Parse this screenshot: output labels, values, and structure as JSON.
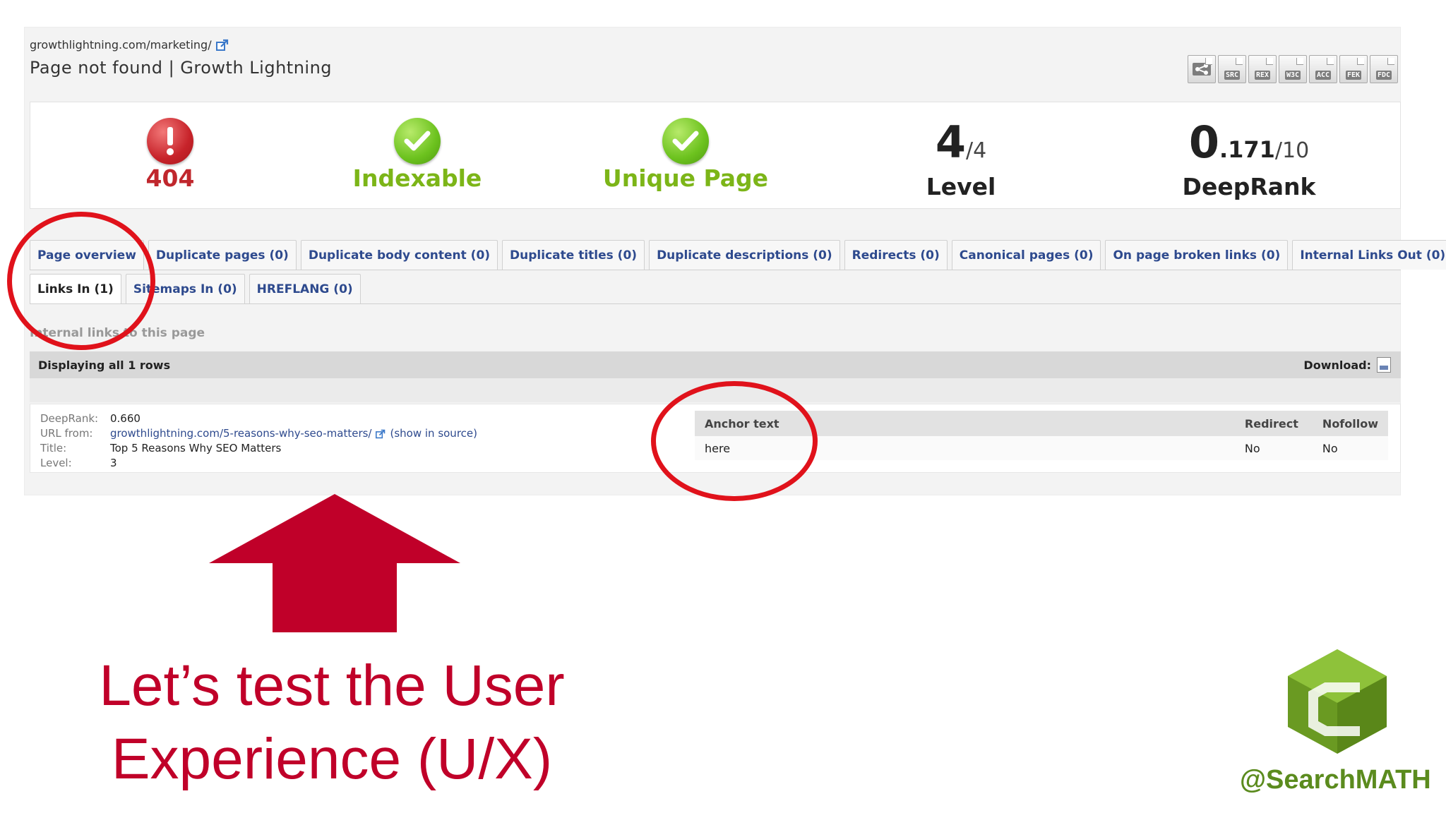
{
  "header": {
    "url": "growthlightning.com/marketing/",
    "title": "Page not found | Growth Lightning"
  },
  "toolbar": {
    "buttons": [
      "SRC",
      "REX",
      "W3C",
      "ACC",
      "FEK",
      "FDC"
    ]
  },
  "stats": {
    "status": {
      "value": "404",
      "icon": "error-icon"
    },
    "indexable": {
      "label": "Indexable",
      "icon": "check-icon"
    },
    "unique": {
      "label": "Unique Page",
      "icon": "check-icon"
    },
    "level": {
      "value": "4",
      "of": "/4",
      "label": "Level"
    },
    "deeprank": {
      "int": "0",
      "dec": ".171",
      "of": "/10",
      "label": "DeepRank"
    }
  },
  "tabs": {
    "row1": [
      "Page overview",
      "Duplicate pages (0)",
      "Duplicate body content (0)",
      "Duplicate titles (0)",
      "Duplicate descriptions (0)",
      "Redirects (0)",
      "Canonical pages (0)",
      "On page broken links (0)",
      "Internal Links Out (0)"
    ],
    "row2": [
      "Links In (1)",
      "Sitemaps In (0)",
      "HREFLANG (0)"
    ]
  },
  "section": {
    "label": "Internal links to this page",
    "displaying": "Displaying all 1 rows",
    "download": "Download:"
  },
  "row": {
    "deeprank_label": "DeepRank:",
    "deeprank_value": "0.660",
    "url_label": "URL from:",
    "url_value": "growthlightning.com/5-reasons-why-seo-matters/",
    "show_source": "(show in source)",
    "title_label": "Title:",
    "title_value": "Top 5 Reasons Why SEO Matters",
    "level_label": "Level:",
    "level_value": "3"
  },
  "anchor_table": {
    "headers": [
      "Anchor text",
      "Redirect",
      "Nofollow"
    ],
    "rows": [
      [
        "here",
        "No",
        "No"
      ]
    ]
  },
  "slide": {
    "caption_line1": "Let’s test the User",
    "caption_line2": "Experience (U/X)",
    "handle": "@SearchMATH"
  },
  "colors": {
    "accent_red": "#c00029",
    "ring_red": "#e0121b",
    "ok_green": "#7cb518",
    "link_blue": "#2e4a8e",
    "logo_green": "#5b8b1e"
  }
}
